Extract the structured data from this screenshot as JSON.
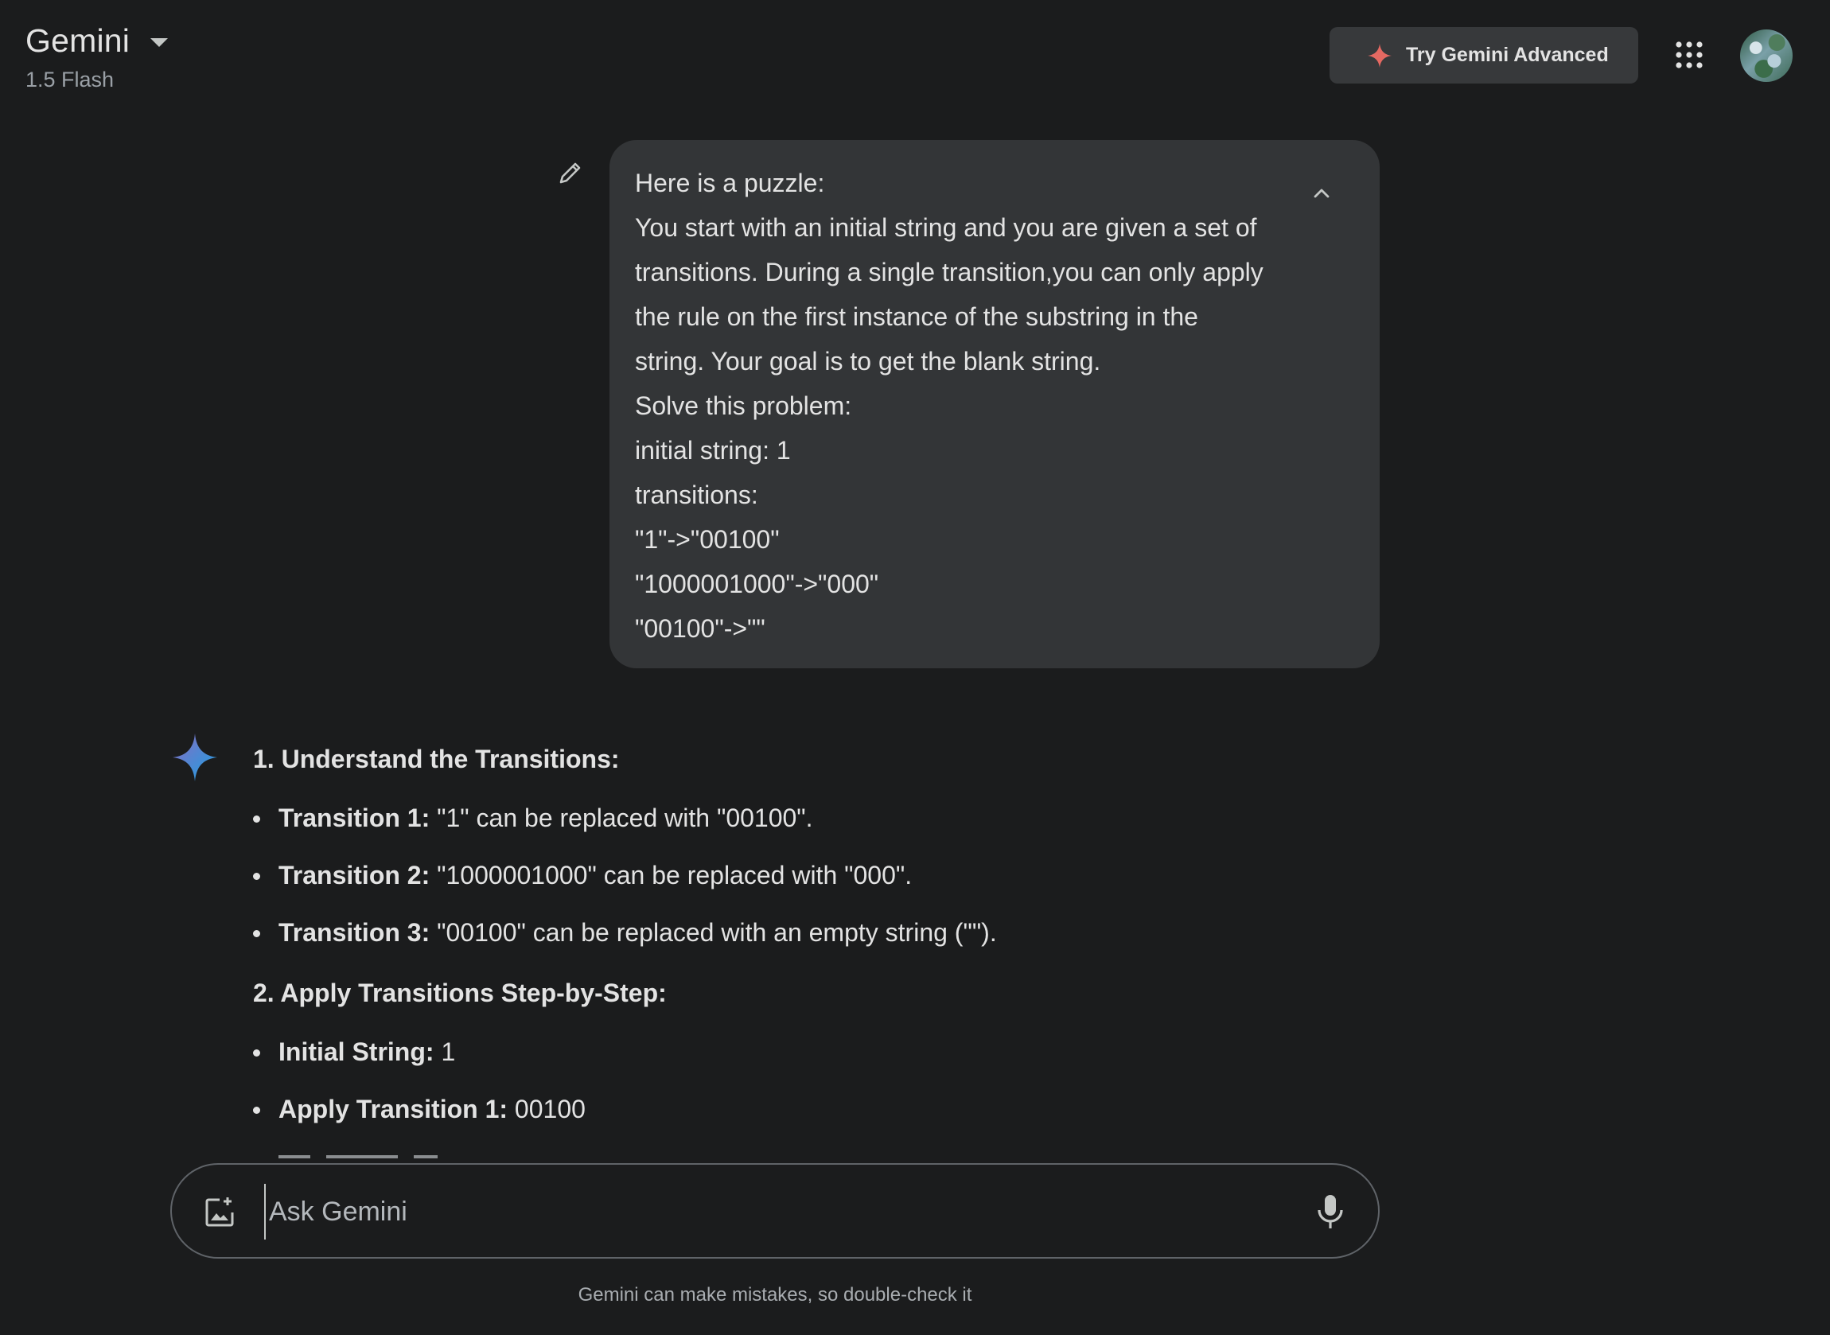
{
  "header": {
    "app_title": "Gemini",
    "model": "1.5 Flash",
    "advanced_button": "Try Gemini Advanced",
    "icons": [
      "chevron-down-icon",
      "sparkle-icon",
      "apps-grid-icon",
      "avatar"
    ]
  },
  "user_message": {
    "lines": [
      "Here is a puzzle:",
      "You start with an initial string and you are given a set of",
      "transitions. During a single transition,you can only apply",
      "the rule on the first instance of the substring in the",
      "string. Your goal is to get the blank string.",
      "Solve this problem:",
      "initial string: 1",
      "transitions:",
      "\"1\"->\"00100\"",
      "\"1000001000\"->\"000\"",
      "\"00100\"->\"\""
    ]
  },
  "response": {
    "section1": {
      "heading": "1. Understand the Transitions:",
      "items": [
        {
          "label": "Transition 1:",
          "text": " \"1\" can be replaced with \"00100\"."
        },
        {
          "label": "Transition 2:",
          "text": " \"1000001000\" can be replaced with \"000\"."
        },
        {
          "label": "Transition 3:",
          "text": " \"00100\" can be replaced with an empty string (\"\")."
        }
      ]
    },
    "section2": {
      "heading": "2. Apply Transitions Step-by-Step:",
      "items": [
        {
          "label": "Initial String:",
          "text": " 1"
        },
        {
          "label": "Apply Transition 1:",
          "text": " 00100"
        }
      ]
    }
  },
  "input": {
    "placeholder": "Ask Gemini"
  },
  "footer": {
    "disclaimer": "Gemini can make mistakes, so double-check it"
  },
  "colors": {
    "background": "#1b1c1d",
    "bubble": "#333537",
    "text": "#e3e3e3",
    "sparkle_red": "#e46962",
    "gemini_blue": "#4c8df6"
  }
}
